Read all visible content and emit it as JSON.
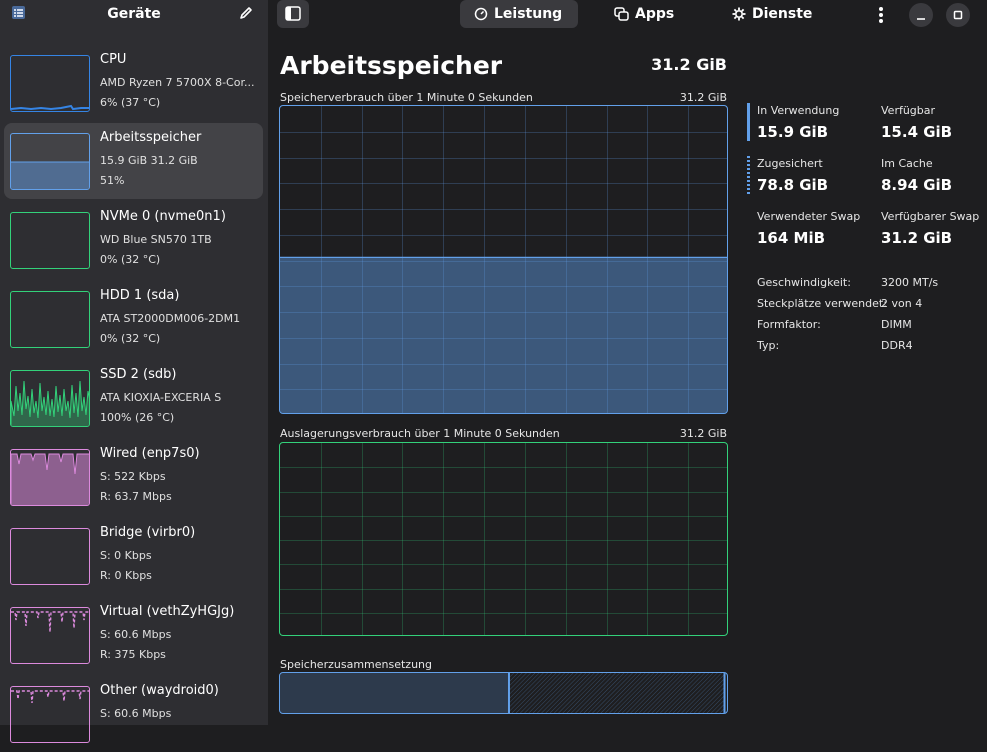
{
  "sidebar": {
    "title": "Geräte",
    "devices": [
      {
        "name": "CPU",
        "line1": "AMD Ryzen 7 5700X 8-Cor...",
        "line2": "6% (37 °C)",
        "color": "#3584e4",
        "selected": false
      },
      {
        "name": "Arbeitsspeicher",
        "line1": "15.9 GiB 31.2 GiB",
        "line2": "51%",
        "color": "#62a0ea",
        "selected": true
      },
      {
        "name": "NVMe 0 (nvme0n1)",
        "line1": "WD Blue SN570 1TB",
        "line2": "0% (32 °C)",
        "color": "#33d17a",
        "selected": false
      },
      {
        "name": "HDD 1 (sda)",
        "line1": "ATA ST2000DM006-2DM1",
        "line2": "0% (32 °C)",
        "color": "#33d17a",
        "selected": false
      },
      {
        "name": "SSD 2 (sdb)",
        "line1": "ATA KIOXIA-EXCERIA S",
        "line2": "100% (26 °C)",
        "color": "#33d17a",
        "selected": false
      },
      {
        "name": "Wired (enp7s0)",
        "line1": "S: 522 Kbps",
        "line2": "R: 63.7 Mbps",
        "color": "#dc8add",
        "selected": false
      },
      {
        "name": "Bridge (virbr0)",
        "line1": "S: 0 Kbps",
        "line2": "R: 0 Kbps",
        "color": "#dc8add",
        "selected": false
      },
      {
        "name": "Virtual (vethZyHGJg)",
        "line1": "S: 60.6 Mbps",
        "line2": "R: 375 Kbps",
        "color": "#dc8add",
        "selected": false
      },
      {
        "name": "Other (waydroid0)",
        "line1": "S: 60.6 Mbps",
        "line2": "",
        "color": "#dc8add",
        "selected": false
      }
    ]
  },
  "tabs": [
    {
      "label": "Leistung",
      "icon": "speedometer-icon",
      "active": true
    },
    {
      "label": "Apps",
      "icon": "apps-icon",
      "active": false
    },
    {
      "label": "Dienste",
      "icon": "gear-icon",
      "active": false
    }
  ],
  "main": {
    "title": "Arbeitsspeicher",
    "total": "31.2 GiB",
    "memory_graph": {
      "label": "Speicherverbrauch über 1 Minute 0 Sekunden",
      "max": "31.2 GiB",
      "color": "#62a0ea",
      "usage_fraction": 0.51
    },
    "swap_graph": {
      "label": "Auslagerungsverbrauch über 1 Minute 0 Sekunden",
      "max": "31.2 GiB",
      "color": "#33d17a"
    },
    "composition": {
      "label": "Speicherzusammensetzung",
      "used_fraction": 0.51,
      "cached_fraction": 0.99
    }
  },
  "stats": {
    "in_use_label": "In Verwendung",
    "in_use_value": "15.9 GiB",
    "available_label": "Verfügbar",
    "available_value": "15.4 GiB",
    "committed_label": "Zugesichert",
    "committed_value": "78.8 GiB",
    "cache_label": "Im Cache",
    "cache_value": "8.94 GiB",
    "swap_used_label": "Verwendeter Swap",
    "swap_used_value": "164 MiB",
    "swap_avail_label": "Verfügbarer Swap",
    "swap_avail_value": "31.2 GiB"
  },
  "props": [
    {
      "label": "Geschwindigkeit:",
      "value": "3200 MT/s"
    },
    {
      "label": "Steckplätze verwendet:",
      "value": "2 von 4"
    },
    {
      "label": "Formfaktor:",
      "value": "DIMM"
    },
    {
      "label": "Typ:",
      "value": "DDR4"
    }
  ]
}
